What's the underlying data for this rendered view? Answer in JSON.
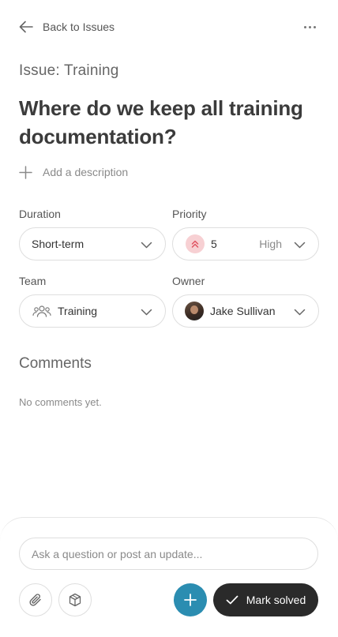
{
  "header": {
    "back_label": "Back to Issues",
    "more_icon": "more-horizontal-icon"
  },
  "issue": {
    "type_label": "Issue: Training",
    "title": "Where do we keep all training documentation?",
    "add_description_label": "Add a description"
  },
  "fields": {
    "duration": {
      "label": "Duration",
      "value": "Short-term"
    },
    "priority": {
      "label": "Priority",
      "value": "5",
      "level": "High",
      "icon": "double-chevron-up-icon",
      "color": "#e05563"
    },
    "team": {
      "label": "Team",
      "value": "Training",
      "icon": "users-icon"
    },
    "owner": {
      "label": "Owner",
      "value": "Jake Sullivan"
    }
  },
  "comments": {
    "heading": "Comments",
    "empty_text": "No comments yet."
  },
  "composer": {
    "placeholder": "Ask a question or post an update...",
    "attach_icon": "paperclip-icon",
    "package_icon": "box-icon",
    "add_icon": "plus-icon",
    "solve_label": "Mark solved"
  },
  "colors": {
    "accent": "#2b8db1",
    "primary_button": "#2a2a2a",
    "priority_bg": "#f7d0d3"
  }
}
